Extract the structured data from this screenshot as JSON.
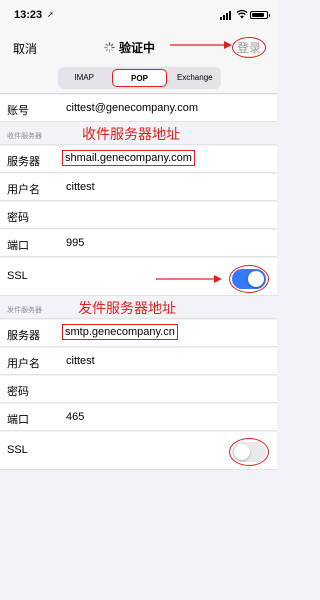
{
  "status_bar": {
    "time": "13:23",
    "location_icon": "location-arrow-icon",
    "battery_level": 0.85
  },
  "nav": {
    "cancel": "取消",
    "title": "验证中",
    "login": "登录"
  },
  "tabs": {
    "items": [
      "IMAP",
      "POP",
      "Exchange"
    ],
    "selected": "POP"
  },
  "account": {
    "label": "账号",
    "value": "cittest@genecompany.com"
  },
  "incoming": {
    "section": "收件服务器",
    "annotation": "收件服务器地址",
    "server_label": "服务器",
    "server": "shmail.genecompany.com",
    "username_label": "用户名",
    "username": "cittest",
    "password_label": "密码",
    "port_label": "端口",
    "port": "995",
    "ssl_label": "SSL",
    "ssl_on": true
  },
  "outgoing": {
    "section": "发件服务器",
    "annotation": "发件服务器地址",
    "server_label": "服务器",
    "server": "smtp.genecompany.cn",
    "username_label": "用户名",
    "username": "cittest",
    "password_label": "密码",
    "port_label": "端口",
    "port": "465",
    "ssl_label": "SSL",
    "ssl_on": false
  },
  "colors": {
    "annotation_red": "#e02020",
    "toggle_blue": "#3478f6"
  }
}
